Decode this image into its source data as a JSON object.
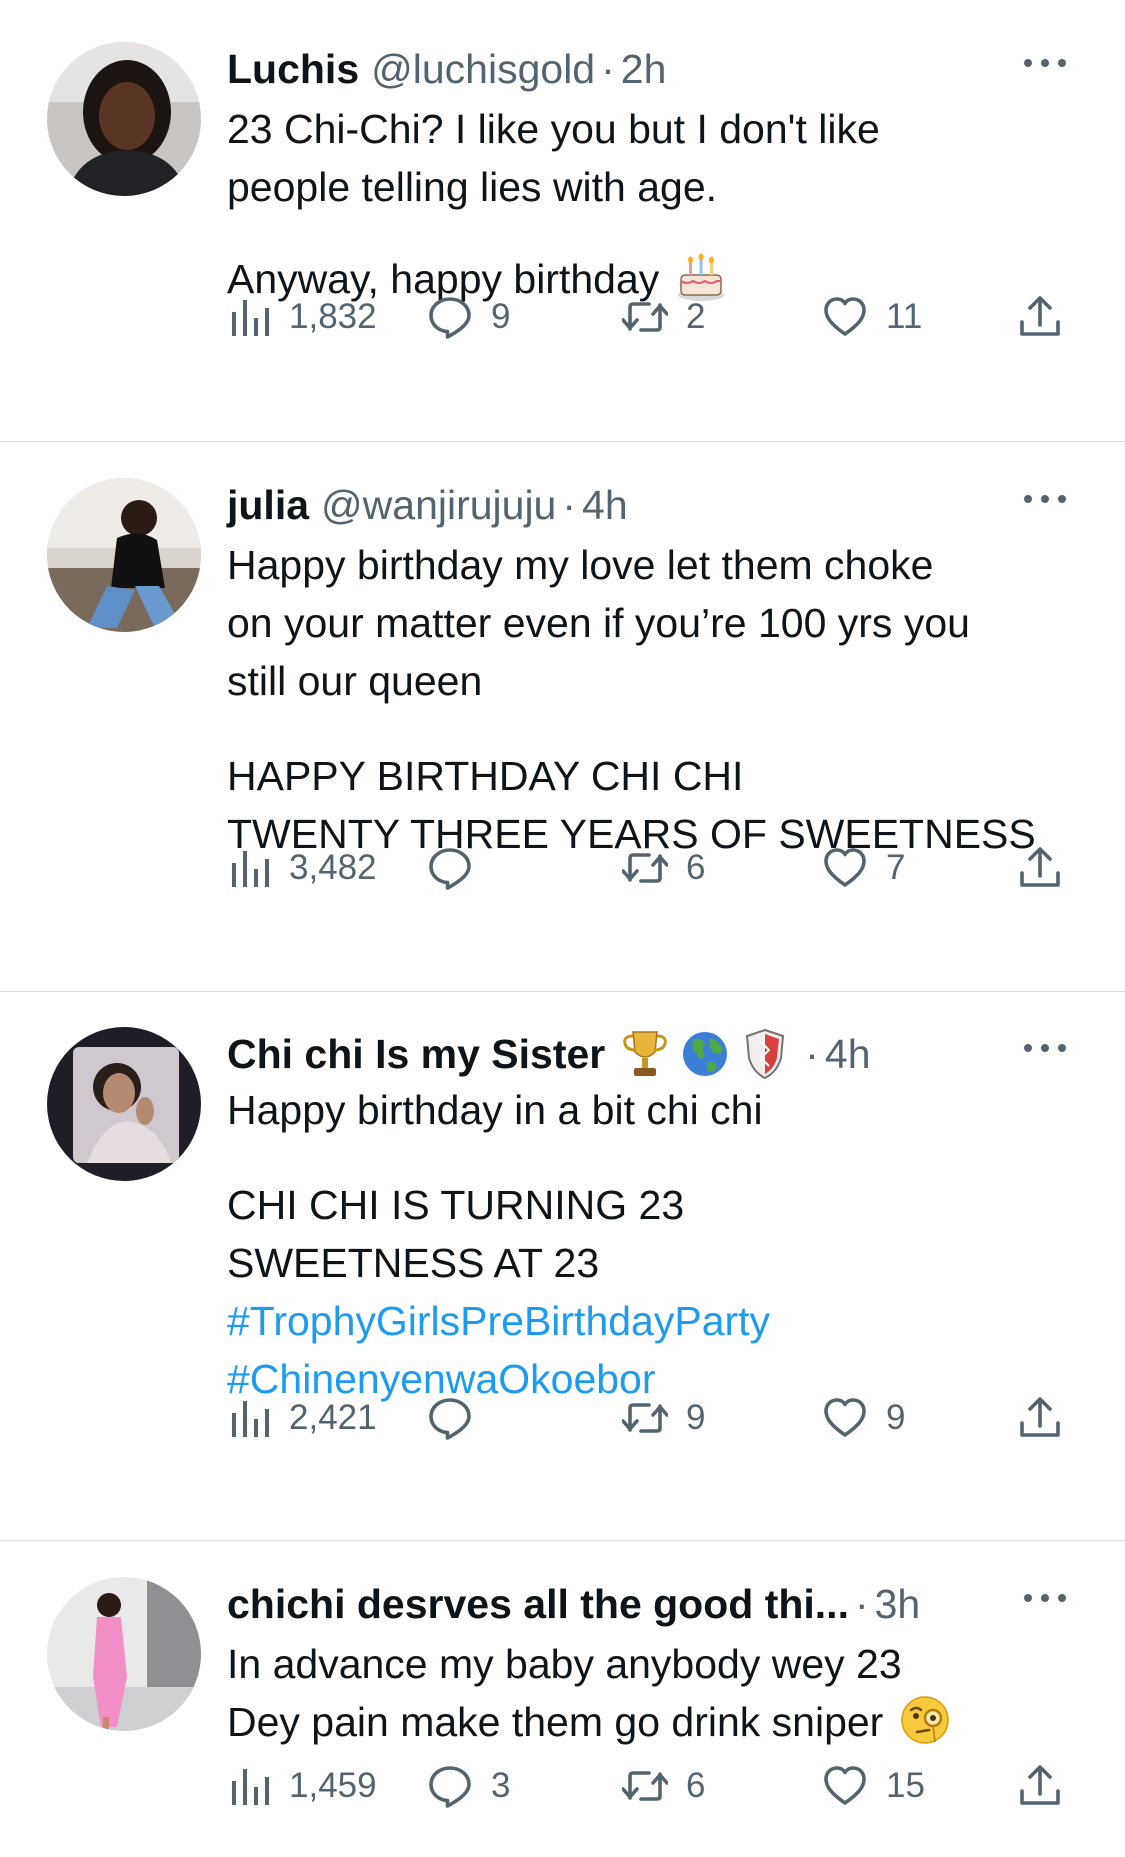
{
  "colors": {
    "text": "#0f1419",
    "secondary": "#536471",
    "link": "#1d9bf0",
    "divider": "#d9dde0"
  },
  "tweets": [
    {
      "name": "Luchis",
      "handle": "@luchisgold",
      "separator": "·",
      "time": "2h",
      "lines": [
        "23 Chi-Chi? I like you but I don't like",
        "people telling lies with age.",
        "",
        "Anyway, happy birthday"
      ],
      "trailing_emoji": "birthday-cake-icon",
      "views": "1,832",
      "replies": "9",
      "retweets": "2",
      "likes": "11"
    },
    {
      "name": "julia",
      "handle": "@wanjirujuju",
      "separator": "·",
      "time": "4h",
      "lines": [
        "Happy birthday my love let them choke",
        "on your matter even if you’re 100 yrs you",
        "still our queen",
        "",
        "HAPPY BIRTHDAY CHI CHI",
        "TWENTY THREE YEARS OF SWEETNESS"
      ],
      "views": "3,482",
      "replies": "",
      "retweets": "6",
      "likes": "7"
    },
    {
      "name": "Chi chi Is my Sister",
      "badges": [
        "trophy-icon",
        "globe-icon",
        "shield-icon"
      ],
      "separator": "·",
      "time": "4h",
      "lines": [
        "Happy birthday in a bit chi chi",
        "",
        "CHI CHI IS TURNING 23",
        "SWEETNESS AT 23"
      ],
      "hashtags": [
        "#TrophyGirlsPreBirthdayParty",
        "#ChinenyenwaOkoebor"
      ],
      "views": "2,421",
      "replies": "",
      "retweets": "9",
      "likes": "9"
    },
    {
      "name": "chichi desrves all the good thi...",
      "separator": "·",
      "time": "3h",
      "lines": [
        "In advance my baby anybody wey 23",
        "Dey pain make them go drink sniper"
      ],
      "trailing_emoji": "face-with-monocle-icon",
      "views": "1,459",
      "replies": "3",
      "retweets": "6",
      "likes": "15"
    }
  ]
}
